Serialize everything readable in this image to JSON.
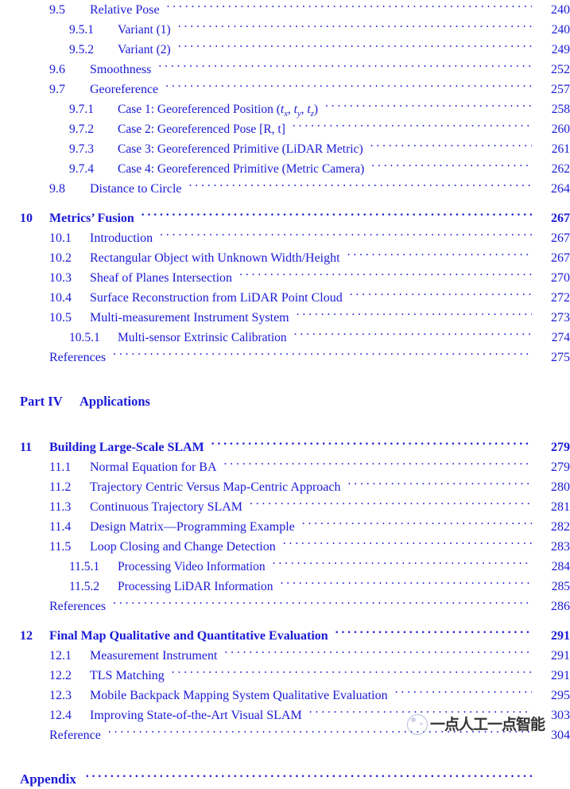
{
  "page": {
    "text_color": "#1a1ad6",
    "background_color": "#ffffff"
  },
  "entries": [
    {
      "level": "section",
      "number": "9.5",
      "label": "Relative Pose",
      "page": "240"
    },
    {
      "level": "subsection",
      "number": "9.5.1",
      "label": "Variant (1)",
      "page": "240"
    },
    {
      "level": "subsection",
      "number": "9.5.2",
      "label": "Variant (2)",
      "page": "249"
    },
    {
      "level": "section",
      "number": "9.6",
      "label": "Smoothness",
      "page": "252"
    },
    {
      "level": "section",
      "number": "9.7",
      "label": "Georeference",
      "page": "257"
    },
    {
      "level": "subsection",
      "number": "9.7.1",
      "label": "Case 1: Georeferenced Position (tx, ty, tz)",
      "page": "258",
      "math": true
    },
    {
      "level": "subsection",
      "number": "9.7.2",
      "label": "Case 2: Georeferenced Pose [R, t]",
      "page": "260"
    },
    {
      "level": "subsection",
      "number": "9.7.3",
      "label": "Case 3: Georeferenced Primitive (LiDAR Metric)",
      "page": "261"
    },
    {
      "level": "subsection",
      "number": "9.7.4",
      "label": "Case 4: Georeferenced Primitive (Metric Camera)",
      "page": "262"
    },
    {
      "level": "section",
      "number": "9.8",
      "label": "Distance to Circle",
      "page": "264"
    },
    {
      "level": "chapter",
      "number": "10",
      "label": "Metrics’ Fusion",
      "page": "267"
    },
    {
      "level": "section",
      "number": "10.1",
      "label": "Introduction",
      "page": "267"
    },
    {
      "level": "section",
      "number": "10.2",
      "label": "Rectangular Object with Unknown Width/Height",
      "page": "267"
    },
    {
      "level": "section",
      "number": "10.3",
      "label": "Sheaf of Planes Intersection",
      "page": "270"
    },
    {
      "level": "section",
      "number": "10.4",
      "label": "Surface Reconstruction from LiDAR Point Cloud",
      "page": "272"
    },
    {
      "level": "section",
      "number": "10.5",
      "label": "Multi-measurement Instrument System",
      "page": "273"
    },
    {
      "level": "subsection",
      "number": "10.5.1",
      "label": "Multi-sensor Extrinsic Calibration",
      "page": "274"
    },
    {
      "level": "references",
      "number": "",
      "label": "References",
      "page": "275"
    },
    {
      "level": "part",
      "number": "Part IV",
      "label": "Applications",
      "page": ""
    },
    {
      "level": "chapter",
      "number": "11",
      "label": "Building Large-Scale SLAM",
      "page": "279"
    },
    {
      "level": "section",
      "number": "11.1",
      "label": "Normal Equation for BA",
      "page": "279"
    },
    {
      "level": "section",
      "number": "11.2",
      "label": "Trajectory Centric Versus Map-Centric Approach",
      "page": "280"
    },
    {
      "level": "section",
      "number": "11.3",
      "label": "Continuous Trajectory SLAM",
      "page": "281"
    },
    {
      "level": "section",
      "number": "11.4",
      "label": "Design Matrix—Programming Example",
      "page": "282"
    },
    {
      "level": "section",
      "number": "11.5",
      "label": "Loop Closing and Change Detection",
      "page": "283"
    },
    {
      "level": "subsection",
      "number": "11.5.1",
      "label": "Processing Video Information",
      "page": "284"
    },
    {
      "level": "subsection",
      "number": "11.5.2",
      "label": "Processing LiDAR Information",
      "page": "285"
    },
    {
      "level": "references",
      "number": "",
      "label": "References",
      "page": "286"
    },
    {
      "level": "chapter",
      "number": "12",
      "label": "Final Map Qualitative and Quantitative Evaluation",
      "page": "291"
    },
    {
      "level": "section",
      "number": "12.1",
      "label": "Measurement Instrument",
      "page": "291"
    },
    {
      "level": "section",
      "number": "12.2",
      "label": "TLS Matching",
      "page": "291"
    },
    {
      "level": "section",
      "number": "12.3",
      "label": "Mobile Backpack Mapping System Qualitative Evaluation",
      "page": "295"
    },
    {
      "level": "section",
      "number": "12.4",
      "label": "Improving State-of-the-Art Visual SLAM",
      "page": "303"
    },
    {
      "level": "references",
      "number": "",
      "label": "Reference",
      "page": "304"
    },
    {
      "level": "appendix",
      "number": "",
      "label": "Appendix",
      "page": ""
    }
  ],
  "math_entries": {
    "9.7.1": {
      "prefix": "Case 1: Georeferenced Position (",
      "terms": [
        {
          "base": "t",
          "sub": "x"
        },
        {
          "base": "t",
          "sub": "y"
        },
        {
          "base": "t",
          "sub": "z"
        }
      ],
      "suffix": ")"
    }
  },
  "watermark": {
    "logo_name": "circle-logo-icon",
    "text": "一点人工一点智能"
  }
}
